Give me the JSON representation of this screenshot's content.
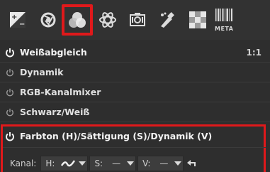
{
  "toolbar": {
    "tools": [
      {
        "name": "tone-curve",
        "icon": "tone-curve-icon"
      },
      {
        "name": "lens",
        "icon": "aperture-icon"
      },
      {
        "name": "color",
        "icon": "color-circles-icon",
        "active": true
      },
      {
        "name": "advanced",
        "icon": "atom-icon"
      },
      {
        "name": "transform",
        "icon": "transform-icon"
      },
      {
        "name": "raw",
        "icon": "raw-pipette-icon"
      },
      {
        "name": "wavelet",
        "icon": "checker-icon"
      },
      {
        "name": "meta",
        "icon": "barcode-icon",
        "label": "META"
      }
    ],
    "accent": "#e0191b"
  },
  "tools_list": [
    {
      "label": "Weißabgleich",
      "enabled": true,
      "badge": "1:1"
    },
    {
      "label": "Dynamik",
      "enabled": false
    },
    {
      "label": "RGB-Kanalmixer",
      "enabled": false
    },
    {
      "label": "Schwarz/Weiß",
      "enabled": false
    },
    {
      "label": "Farbton (H)/Sättigung (S)/Dynamik (V)",
      "enabled": true
    }
  ],
  "hsv_panel": {
    "channel_label": "Kanal:",
    "channels": [
      {
        "label": "H:",
        "value": "curve"
      },
      {
        "label": "S:",
        "value": "—"
      },
      {
        "label": "V:",
        "value": "—"
      }
    ]
  }
}
